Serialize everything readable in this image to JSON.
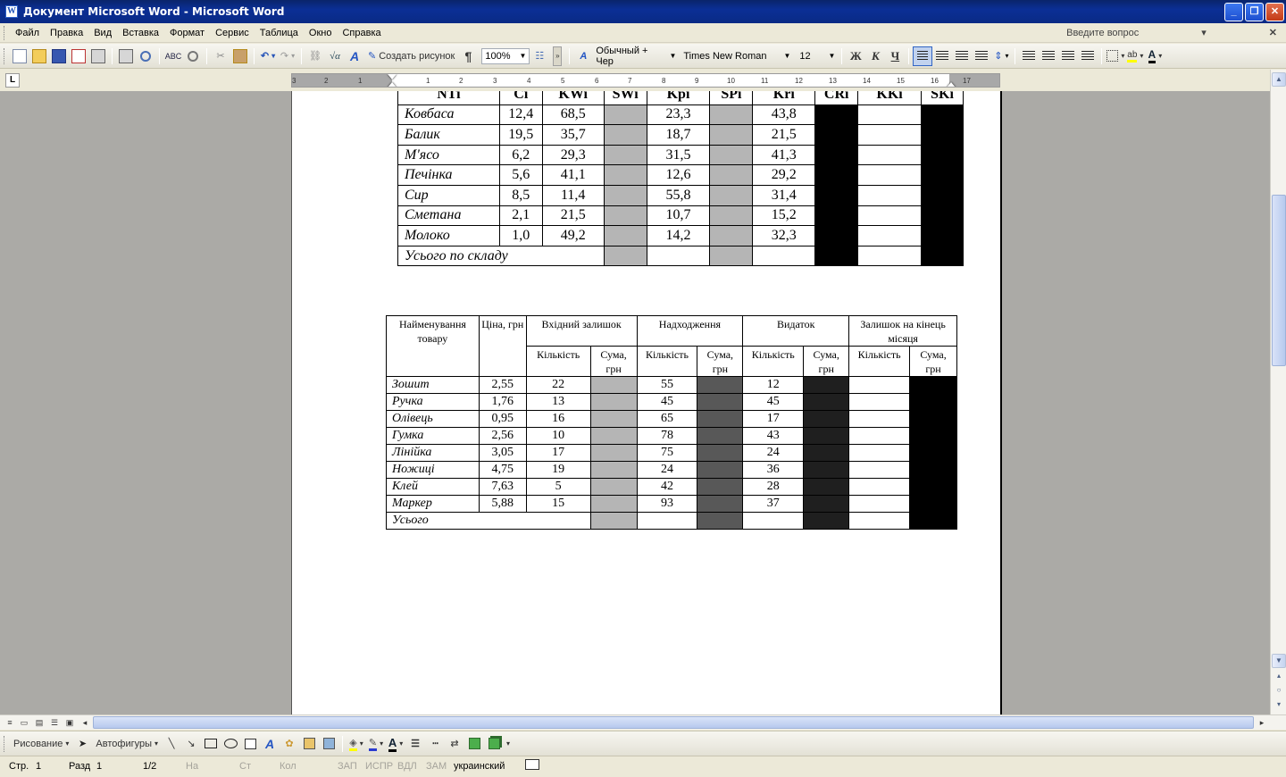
{
  "window": {
    "title": "Документ Microsoft Word - Microsoft Word",
    "app_icon": "W"
  },
  "menu": {
    "items": [
      "Файл",
      "Правка",
      "Вид",
      "Вставка",
      "Формат",
      "Сервис",
      "Таблица",
      "Окно",
      "Справка"
    ],
    "question_placeholder": "Введите вопрос"
  },
  "toolbar": {
    "create_drawing": "Создать рисунок",
    "pilcrow": "¶",
    "zoom": "100%",
    "style": "Обычный + Чер",
    "font": "Times New Roman",
    "size": "12",
    "bold": "Ж",
    "italic": "К",
    "underline": "Ч"
  },
  "ruler": {
    "tab_selector": "L",
    "labels": [
      "3",
      "2",
      "1",
      "1",
      "2",
      "3",
      "4",
      "5",
      "6",
      "7",
      "8",
      "9",
      "10",
      "11",
      "12",
      "13",
      "14",
      "15",
      "16",
      "17"
    ]
  },
  "table1": {
    "headers": [
      "NTi",
      "Ci",
      "KWi",
      "SWi",
      "Kpi",
      "SPi",
      "Kri",
      "CRi",
      "KKi",
      "SKi"
    ],
    "rows": [
      {
        "name": "Ковбаса",
        "ci": "12,4",
        "kwi": "68,5",
        "kpi": "23,3",
        "kri": "43,8"
      },
      {
        "name": "Балик",
        "ci": "19,5",
        "kwi": "35,7",
        "kpi": "18,7",
        "kri": "21,5"
      },
      {
        "name": "М'ясо",
        "ci": "6,2",
        "kwi": "29,3",
        "kpi": "31,5",
        "kri": "41,3"
      },
      {
        "name": "Печінка",
        "ci": "5,6",
        "kwi": "41,1",
        "kpi": "12,6",
        "kri": "29,2"
      },
      {
        "name": "Сир",
        "ci": "8,5",
        "kwi": "11,4",
        "kpi": "55,8",
        "kri": "31,4"
      },
      {
        "name": "Сметана",
        "ci": "2,1",
        "kwi": "21,5",
        "kpi": "10,7",
        "kri": "15,2"
      },
      {
        "name": "Молоко",
        "ci": "1,0",
        "kwi": "49,2",
        "kpi": "14,2",
        "kri": "32,3"
      }
    ],
    "total_label": "Усього по складу"
  },
  "table2": {
    "h_name": "Найменування товару",
    "h_price": "Ціна, грн",
    "h_opening": "Вхідний залишок",
    "h_incoming": "Надходження",
    "h_outgoing": "Видаток",
    "h_closing": "Залишок на кінець місяця",
    "h_qty": "Кількість",
    "h_sum": "Сума, грн",
    "rows": [
      {
        "name": "Зошит",
        "price": "2,55",
        "open_qty": "22",
        "in_qty": "55",
        "out_qty": "12"
      },
      {
        "name": "Ручка",
        "price": "1,76",
        "open_qty": "13",
        "in_qty": "45",
        "out_qty": "45"
      },
      {
        "name": "Олівець",
        "price": "0,95",
        "open_qty": "16",
        "in_qty": "65",
        "out_qty": "17"
      },
      {
        "name": "Гумка",
        "price": "2,56",
        "open_qty": "10",
        "in_qty": "78",
        "out_qty": "43"
      },
      {
        "name": "Лінійка",
        "price": "3,05",
        "open_qty": "17",
        "in_qty": "75",
        "out_qty": "24"
      },
      {
        "name": "Ножиці",
        "price": "4,75",
        "open_qty": "19",
        "in_qty": "24",
        "out_qty": "36"
      },
      {
        "name": "Клей",
        "price": "7,63",
        "open_qty": "5",
        "in_qty": "42",
        "out_qty": "28"
      },
      {
        "name": "Маркер",
        "price": "5,88",
        "open_qty": "15",
        "in_qty": "93",
        "out_qty": "37"
      }
    ],
    "total_label": "Усього"
  },
  "drawbar": {
    "drawing": "Рисование",
    "autoshapes": "Автофигуры"
  },
  "status": {
    "page": "Стр.",
    "page_num": "1",
    "section": "Разд",
    "section_num": "1",
    "pages": "1/2",
    "at": "На",
    "line": "Ст",
    "col": "Кол",
    "rec": "ЗАП",
    "trk": "ИСПР",
    "ext": "ВДЛ",
    "ovr": "ЗАМ",
    "language": "украинский"
  }
}
